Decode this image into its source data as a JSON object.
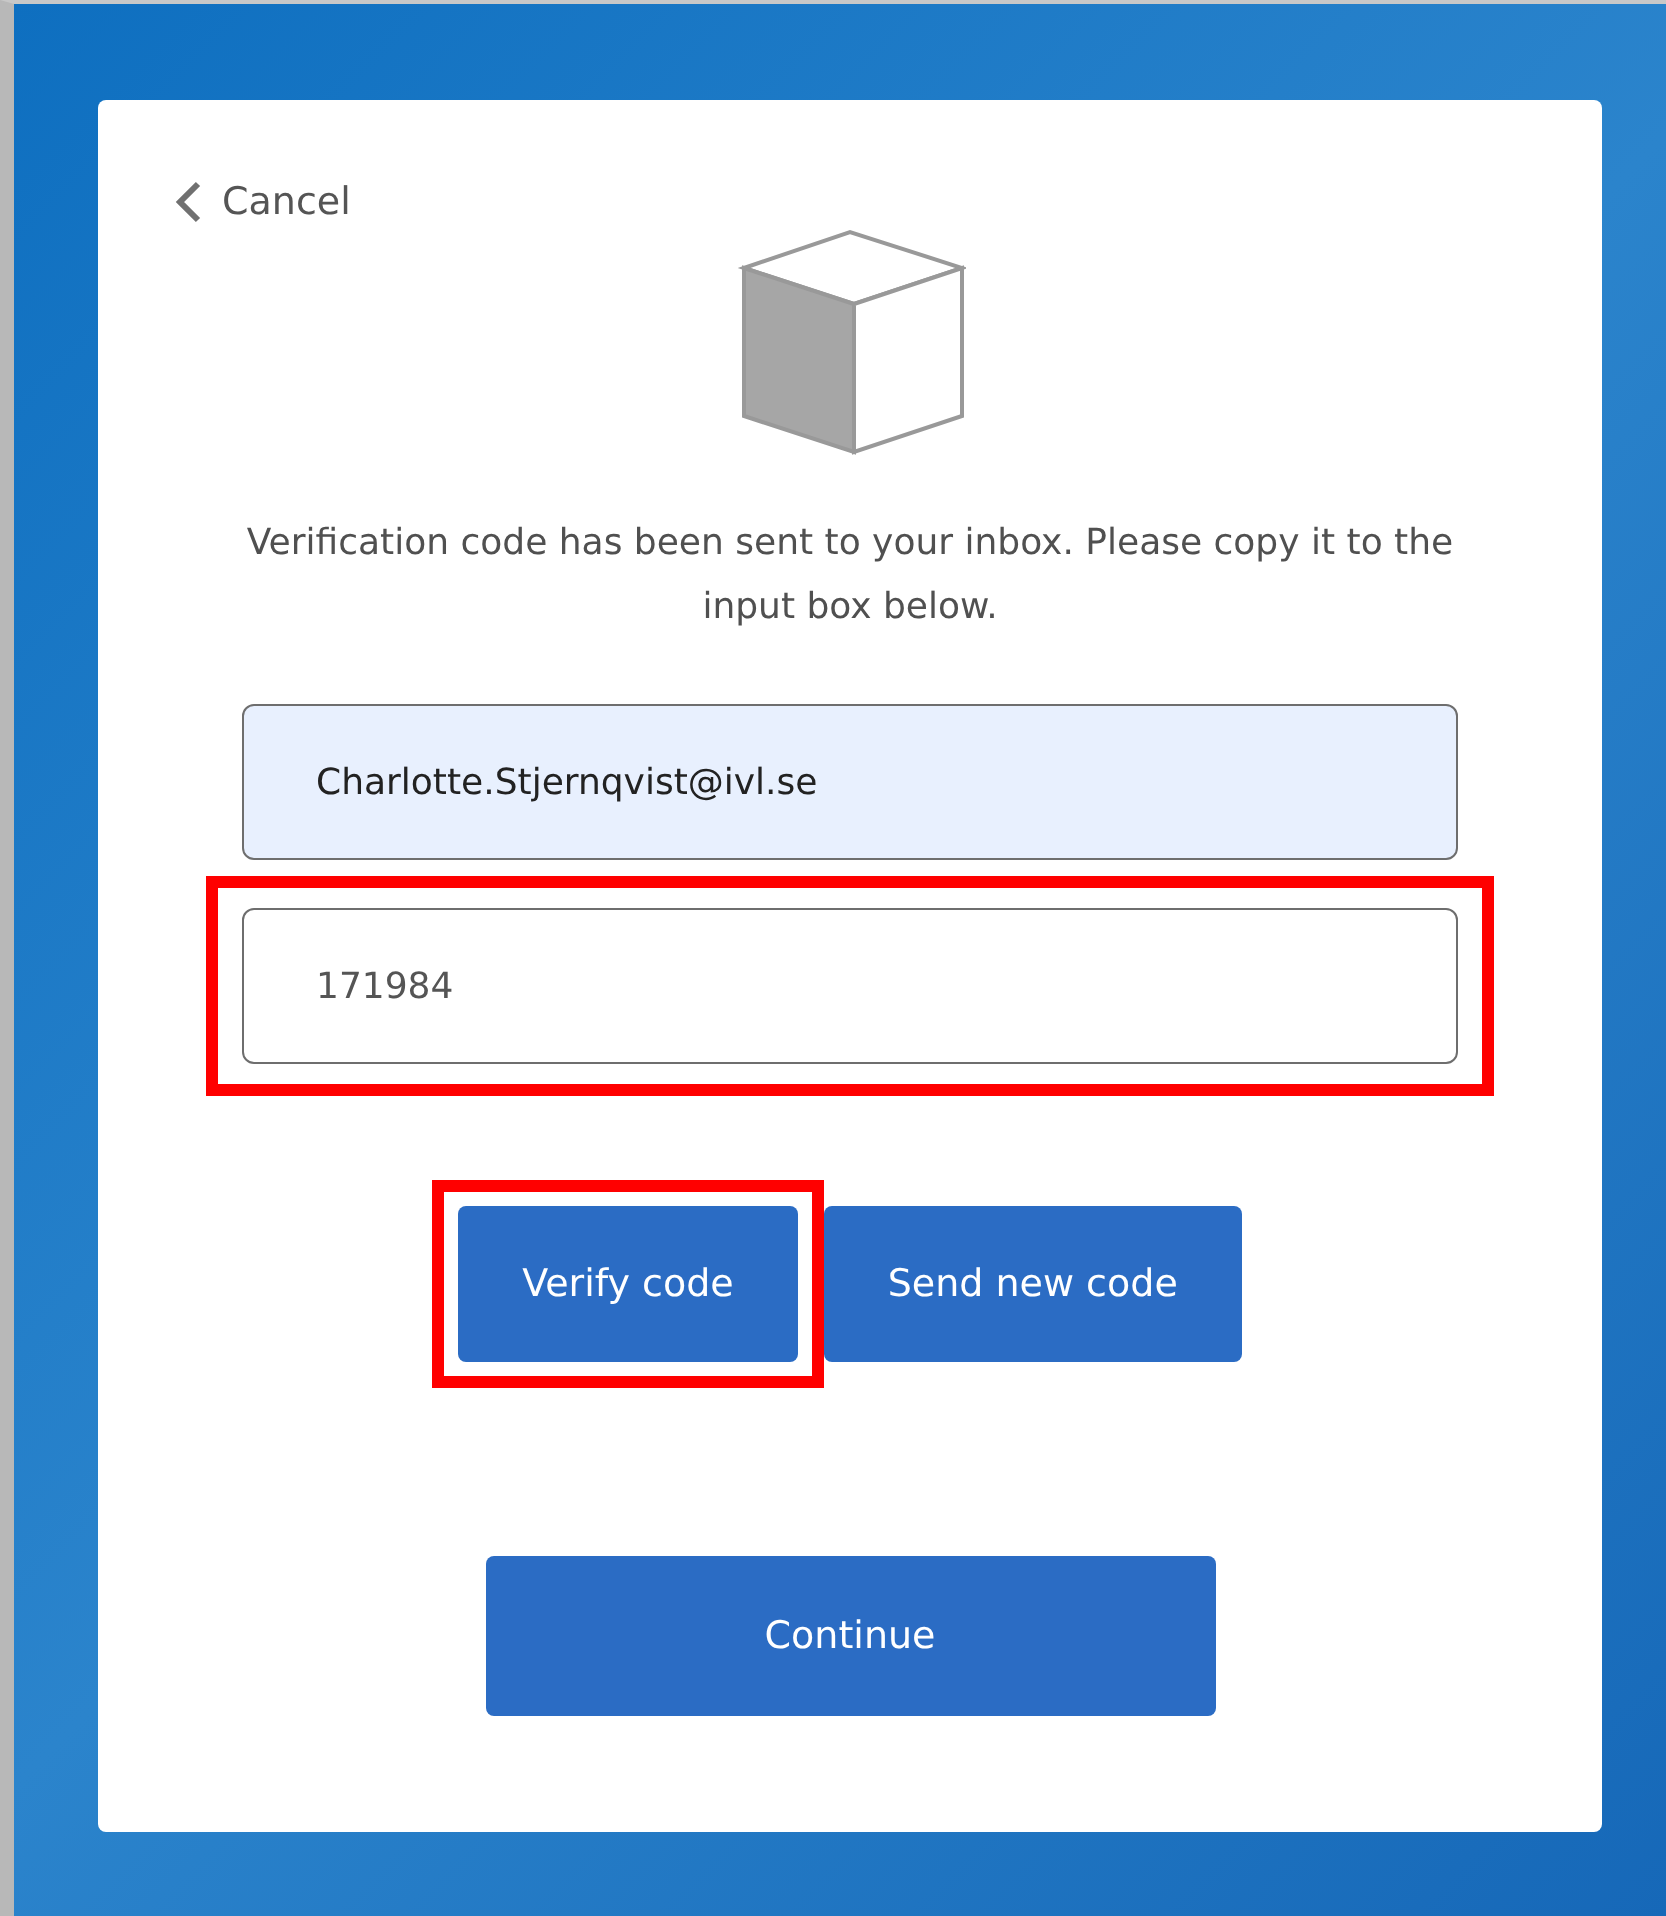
{
  "cancel_link": {
    "label": "Cancel"
  },
  "message": "Verification code has been sent to your inbox. Please copy it to the input box below.",
  "email_field": {
    "value": "Charlotte.Stjernqvist@ivl.se",
    "highlighted": false
  },
  "code_field": {
    "value": "171984",
    "highlighted": true
  },
  "buttons": [
    {
      "label": "Verify code",
      "highlighted": true
    },
    {
      "label": "Send new code",
      "highlighted": false
    }
  ],
  "continue_button": {
    "label": "Continue"
  }
}
